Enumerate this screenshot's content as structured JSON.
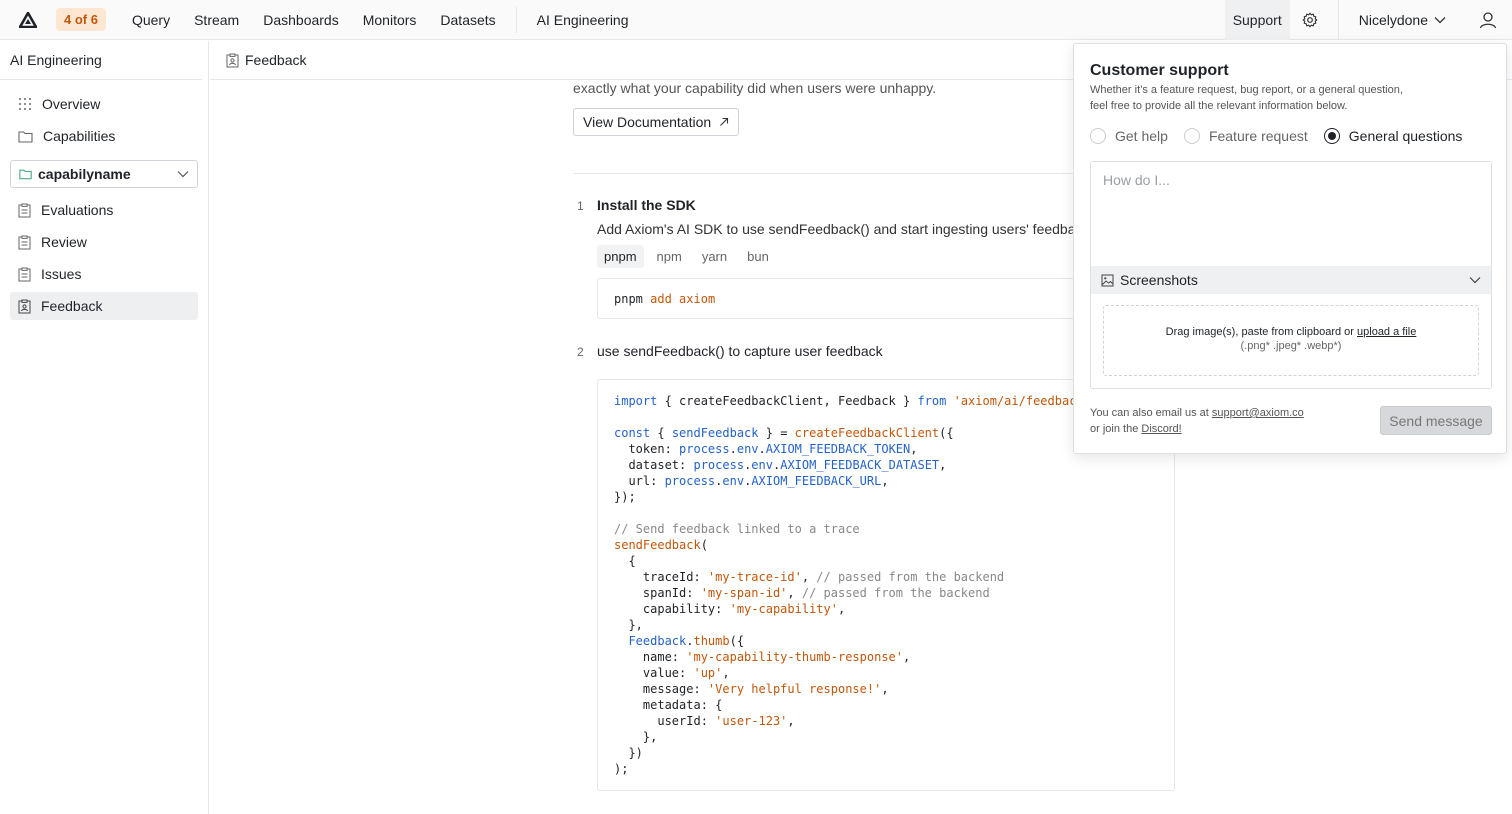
{
  "nav": {
    "badge": "4 of 6",
    "items": [
      "Query",
      "Stream",
      "Dashboards",
      "Monitors",
      "Datasets"
    ],
    "section": "AI Engineering",
    "support": "Support",
    "user": "Nicelydone"
  },
  "sidebar": {
    "title": "AI Engineering",
    "items": [
      "Overview",
      "Capabilities"
    ],
    "capability": "capabilyname",
    "sub_items": [
      "Evaluations",
      "Review",
      "Issues",
      "Feedback"
    ]
  },
  "breadcrumb": "Feedback",
  "main": {
    "intro": "exactly what your capability did when users were unhappy.",
    "doc_button": "View Documentation",
    "step1": {
      "num": "1",
      "title": "Install the SDK",
      "desc": "Add Axiom's AI SDK to use sendFeedback() and start ingesting users' feedba",
      "tabs": [
        "pnpm",
        "npm",
        "yarn",
        "bun"
      ],
      "command": "pnpm",
      "command_args": "add axiom"
    },
    "step2": {
      "num": "2",
      "title": "use sendFeedback() to capture user feedback"
    }
  },
  "support_panel": {
    "title": "Customer support",
    "subtitle_1": "Whether it’s a feature request, bug report, or a general question,",
    "subtitle_2": "feel free to provide all the relevant information below.",
    "options": [
      "Get help",
      "Feature request",
      "General questions"
    ],
    "selected_option": "General questions",
    "placeholder": "How do I...",
    "screenshots_label": "Screenshots",
    "drop_text": "Drag image(s), paste from clipboard or",
    "upload_link": "upload a file",
    "file_types": "(.png* .jpeg* .webp*)",
    "email_prefix": "You can also email us at",
    "email": "support@axiom.co",
    "discord_prefix": "or join the",
    "discord": "Discord!",
    "send": "Send message"
  }
}
